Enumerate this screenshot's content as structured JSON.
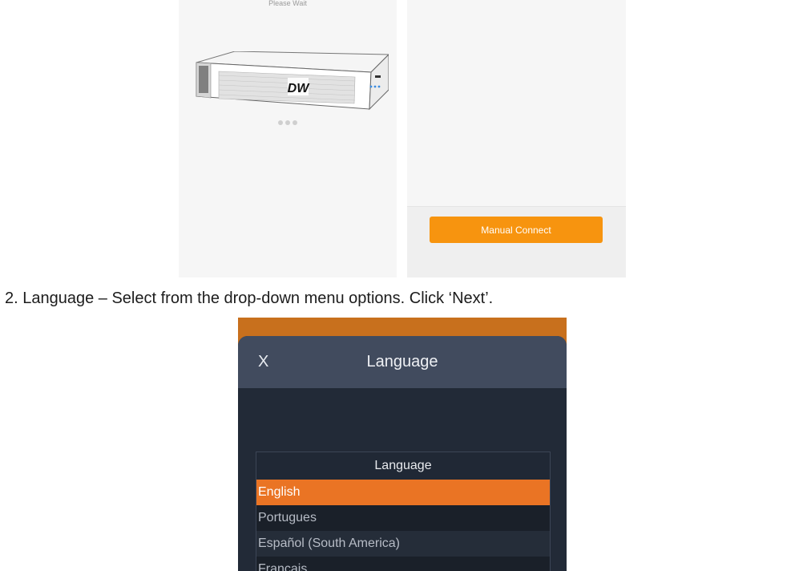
{
  "top_screens": {
    "left_panel": {
      "status_text": "Please Wait",
      "device_logo": "DW",
      "device_icon": "nvr-recorder-icon",
      "loading_indicator": "three-dots-icon"
    },
    "right_panel": {
      "manual_connect_label": "Manual Connect"
    }
  },
  "instruction": "2. Language – Select from the drop-down menu options. Click ‘Next’.",
  "language_screen": {
    "close_label": "X",
    "title": "Language",
    "list": {
      "header": "Language",
      "options": [
        "English",
        "Portugues",
        "Español (South America)",
        "Francais"
      ],
      "selected": "English"
    }
  },
  "colors": {
    "accent_orange": "#f7940f",
    "selected_orange": "#ea7424",
    "sheet_header": "#414b5e",
    "sheet_body": "#222a37",
    "backdrop_orange": "#c8701d"
  }
}
